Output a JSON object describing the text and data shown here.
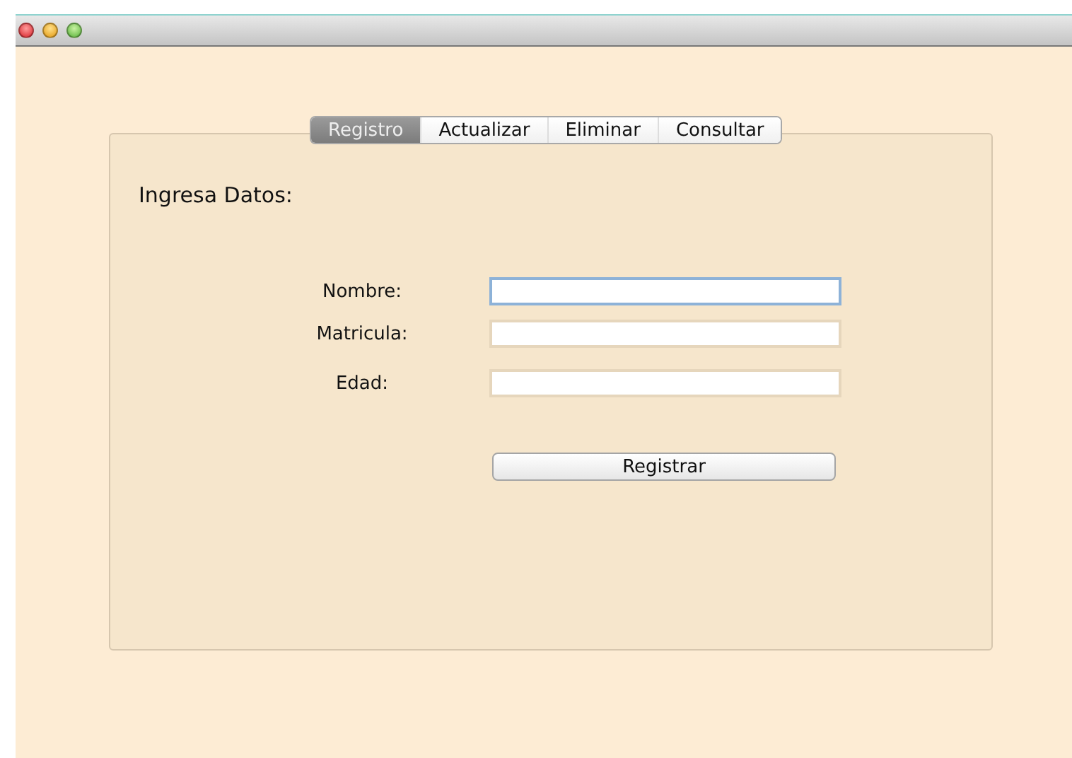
{
  "tabs": [
    {
      "label": "Registro",
      "selected": true
    },
    {
      "label": "Actualizar",
      "selected": false
    },
    {
      "label": "Eliminar",
      "selected": false
    },
    {
      "label": "Consultar",
      "selected": false
    }
  ],
  "heading": "Ingresa Datos:",
  "fields": [
    {
      "label": "Nombre:",
      "focused": true
    },
    {
      "label": "Matricula:",
      "focused": false
    },
    {
      "label": "Edad:",
      "focused": false
    }
  ],
  "button": "Registrar"
}
